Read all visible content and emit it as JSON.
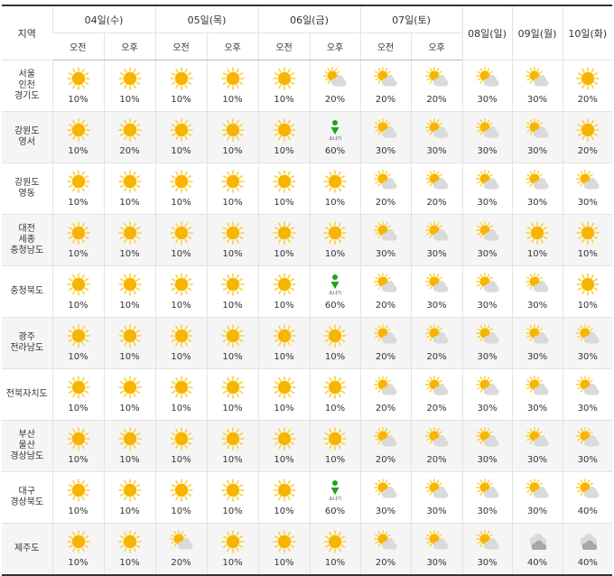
{
  "header": {
    "region_label": "지역",
    "days": [
      "04일(수)",
      "05일(목)",
      "06일(금)",
      "07일(토)"
    ],
    "single_days": [
      "08일(일)",
      "09일(월)",
      "10일(화)"
    ],
    "am_label": "오전",
    "pm_label": "오후"
  },
  "shower_label": "소나기",
  "rows": [
    {
      "region": [
        "서울",
        "인천",
        "경기도"
      ],
      "cells": [
        {
          "icon": "sun-icon",
          "pct": "10%"
        },
        {
          "icon": "sun-icon",
          "pct": "10%"
        },
        {
          "icon": "sun-icon",
          "pct": "10%"
        },
        {
          "icon": "sun-icon",
          "pct": "10%"
        },
        {
          "icon": "sun-icon",
          "pct": "10%"
        },
        {
          "icon": "partly-cloudy-icon",
          "pct": "20%"
        },
        {
          "icon": "partly-cloudy-icon",
          "pct": "20%"
        },
        {
          "icon": "partly-cloudy-icon",
          "pct": "20%"
        },
        {
          "icon": "partly-cloudy-icon",
          "pct": "30%"
        },
        {
          "icon": "partly-cloudy-icon",
          "pct": "30%"
        },
        {
          "icon": "sun-icon",
          "pct": "20%"
        }
      ]
    },
    {
      "region": [
        "강원도",
        "영서"
      ],
      "cells": [
        {
          "icon": "sun-icon",
          "pct": "10%"
        },
        {
          "icon": "sun-icon",
          "pct": "20%"
        },
        {
          "icon": "sun-icon",
          "pct": "10%"
        },
        {
          "icon": "sun-icon",
          "pct": "10%"
        },
        {
          "icon": "sun-icon",
          "pct": "10%"
        },
        {
          "icon": "shower-icon",
          "pct": "60%"
        },
        {
          "icon": "partly-cloudy-icon",
          "pct": "30%"
        },
        {
          "icon": "partly-cloudy-icon",
          "pct": "30%"
        },
        {
          "icon": "partly-cloudy-icon",
          "pct": "30%"
        },
        {
          "icon": "partly-cloudy-icon",
          "pct": "30%"
        },
        {
          "icon": "sun-icon",
          "pct": "20%"
        }
      ]
    },
    {
      "region": [
        "강원도",
        "영동"
      ],
      "cells": [
        {
          "icon": "sun-icon",
          "pct": "10%"
        },
        {
          "icon": "sun-icon",
          "pct": "10%"
        },
        {
          "icon": "sun-icon",
          "pct": "10%"
        },
        {
          "icon": "sun-icon",
          "pct": "10%"
        },
        {
          "icon": "sun-icon",
          "pct": "10%"
        },
        {
          "icon": "sun-icon",
          "pct": "10%"
        },
        {
          "icon": "partly-cloudy-icon",
          "pct": "20%"
        },
        {
          "icon": "partly-cloudy-icon",
          "pct": "20%"
        },
        {
          "icon": "partly-cloudy-icon",
          "pct": "30%"
        },
        {
          "icon": "partly-cloudy-icon",
          "pct": "30%"
        },
        {
          "icon": "partly-cloudy-icon",
          "pct": "30%"
        }
      ]
    },
    {
      "region": [
        "대전",
        "세종",
        "충청남도"
      ],
      "cells": [
        {
          "icon": "sun-icon",
          "pct": "10%"
        },
        {
          "icon": "sun-icon",
          "pct": "10%"
        },
        {
          "icon": "sun-icon",
          "pct": "10%"
        },
        {
          "icon": "sun-icon",
          "pct": "10%"
        },
        {
          "icon": "sun-icon",
          "pct": "10%"
        },
        {
          "icon": "sun-icon",
          "pct": "10%"
        },
        {
          "icon": "partly-cloudy-icon",
          "pct": "30%"
        },
        {
          "icon": "partly-cloudy-icon",
          "pct": "30%"
        },
        {
          "icon": "partly-cloudy-icon",
          "pct": "30%"
        },
        {
          "icon": "sun-icon",
          "pct": "10%"
        },
        {
          "icon": "sun-icon",
          "pct": "10%"
        }
      ]
    },
    {
      "region": [
        "충청북도"
      ],
      "cells": [
        {
          "icon": "sun-icon",
          "pct": "10%"
        },
        {
          "icon": "sun-icon",
          "pct": "10%"
        },
        {
          "icon": "sun-icon",
          "pct": "10%"
        },
        {
          "icon": "sun-icon",
          "pct": "10%"
        },
        {
          "icon": "sun-icon",
          "pct": "10%"
        },
        {
          "icon": "shower-icon",
          "pct": "60%"
        },
        {
          "icon": "partly-cloudy-icon",
          "pct": "20%"
        },
        {
          "icon": "partly-cloudy-icon",
          "pct": "30%"
        },
        {
          "icon": "partly-cloudy-icon",
          "pct": "30%"
        },
        {
          "icon": "partly-cloudy-icon",
          "pct": "30%"
        },
        {
          "icon": "sun-icon",
          "pct": "10%"
        }
      ]
    },
    {
      "region": [
        "광주",
        "전라남도"
      ],
      "cells": [
        {
          "icon": "sun-icon",
          "pct": "10%"
        },
        {
          "icon": "sun-icon",
          "pct": "10%"
        },
        {
          "icon": "sun-icon",
          "pct": "10%"
        },
        {
          "icon": "sun-icon",
          "pct": "10%"
        },
        {
          "icon": "sun-icon",
          "pct": "10%"
        },
        {
          "icon": "sun-icon",
          "pct": "10%"
        },
        {
          "icon": "partly-cloudy-icon",
          "pct": "20%"
        },
        {
          "icon": "partly-cloudy-icon",
          "pct": "20%"
        },
        {
          "icon": "partly-cloudy-icon",
          "pct": "30%"
        },
        {
          "icon": "partly-cloudy-icon",
          "pct": "30%"
        },
        {
          "icon": "partly-cloudy-icon",
          "pct": "30%"
        }
      ]
    },
    {
      "region": [
        "전북자치도"
      ],
      "cells": [
        {
          "icon": "sun-icon",
          "pct": "10%"
        },
        {
          "icon": "sun-icon",
          "pct": "10%"
        },
        {
          "icon": "sun-icon",
          "pct": "10%"
        },
        {
          "icon": "sun-icon",
          "pct": "10%"
        },
        {
          "icon": "sun-icon",
          "pct": "10%"
        },
        {
          "icon": "sun-icon",
          "pct": "10%"
        },
        {
          "icon": "partly-cloudy-icon",
          "pct": "20%"
        },
        {
          "icon": "partly-cloudy-icon",
          "pct": "20%"
        },
        {
          "icon": "partly-cloudy-icon",
          "pct": "30%"
        },
        {
          "icon": "partly-cloudy-icon",
          "pct": "30%"
        },
        {
          "icon": "partly-cloudy-icon",
          "pct": "30%"
        }
      ]
    },
    {
      "region": [
        "부산",
        "울산",
        "경상남도"
      ],
      "cells": [
        {
          "icon": "sun-icon",
          "pct": "10%"
        },
        {
          "icon": "sun-icon",
          "pct": "10%"
        },
        {
          "icon": "sun-icon",
          "pct": "10%"
        },
        {
          "icon": "sun-icon",
          "pct": "10%"
        },
        {
          "icon": "sun-icon",
          "pct": "10%"
        },
        {
          "icon": "sun-icon",
          "pct": "10%"
        },
        {
          "icon": "partly-cloudy-icon",
          "pct": "20%"
        },
        {
          "icon": "partly-cloudy-icon",
          "pct": "20%"
        },
        {
          "icon": "partly-cloudy-icon",
          "pct": "30%"
        },
        {
          "icon": "partly-cloudy-icon",
          "pct": "30%"
        },
        {
          "icon": "partly-cloudy-icon",
          "pct": "30%"
        }
      ]
    },
    {
      "region": [
        "대구",
        "경상북도"
      ],
      "cells": [
        {
          "icon": "sun-icon",
          "pct": "10%"
        },
        {
          "icon": "sun-icon",
          "pct": "10%"
        },
        {
          "icon": "sun-icon",
          "pct": "10%"
        },
        {
          "icon": "sun-icon",
          "pct": "10%"
        },
        {
          "icon": "sun-icon",
          "pct": "10%"
        },
        {
          "icon": "shower-icon",
          "pct": "60%"
        },
        {
          "icon": "partly-cloudy-icon",
          "pct": "30%"
        },
        {
          "icon": "partly-cloudy-icon",
          "pct": "30%"
        },
        {
          "icon": "partly-cloudy-icon",
          "pct": "30%"
        },
        {
          "icon": "partly-cloudy-icon",
          "pct": "30%"
        },
        {
          "icon": "partly-cloudy-icon",
          "pct": "40%"
        }
      ]
    },
    {
      "region": [
        "제주도"
      ],
      "cells": [
        {
          "icon": "sun-icon",
          "pct": "10%"
        },
        {
          "icon": "sun-icon",
          "pct": "10%"
        },
        {
          "icon": "partly-cloudy-icon",
          "pct": "20%"
        },
        {
          "icon": "sun-icon",
          "pct": "10%"
        },
        {
          "icon": "sun-icon",
          "pct": "10%"
        },
        {
          "icon": "sun-icon",
          "pct": "10%"
        },
        {
          "icon": "partly-cloudy-icon",
          "pct": "20%"
        },
        {
          "icon": "partly-cloudy-icon",
          "pct": "30%"
        },
        {
          "icon": "partly-cloudy-icon",
          "pct": "30%"
        },
        {
          "icon": "cloudy-icon",
          "pct": "40%"
        },
        {
          "icon": "cloudy-icon",
          "pct": "40%"
        }
      ]
    }
  ],
  "colors": {
    "sun": "#f7b500",
    "sun_ray": "#ffcf33",
    "cloud": "#dadada",
    "dark_cloud": "#a8a8a8",
    "shower": "#21a31d",
    "alt_row": "#f5f5f5"
  }
}
